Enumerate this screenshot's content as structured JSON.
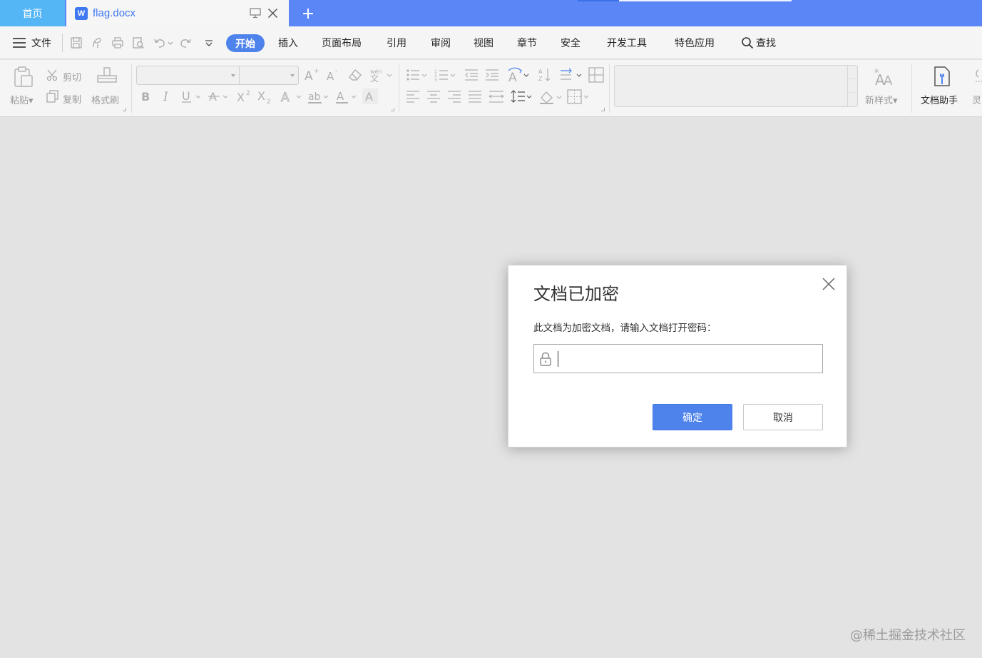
{
  "tabs": {
    "home_label": "首页",
    "doc_icon_letter": "W",
    "doc_title": "flag.docx"
  },
  "menu": {
    "file_label": "文件",
    "items": {
      "start": "开始",
      "insert": "插入",
      "layout": "页面布局",
      "reference": "引用",
      "review": "审阅",
      "view": "视图",
      "chapter": "章节",
      "security": "安全",
      "devtools": "开发工具",
      "features": "特色应用",
      "find": "查找"
    }
  },
  "ribbon": {
    "paste_label": "粘贴",
    "cut_label": "剪切",
    "copy_label": "复制",
    "format_painter_label": "格式刷",
    "font_name": "",
    "font_size": "",
    "new_style_label": "新样式",
    "doc_assistant_label": "文档助手",
    "partial_label": "灵"
  },
  "dialog": {
    "title": "文档已加密",
    "prompt": "此文档为加密文档，请输入文档打开密码：",
    "password_value": "",
    "ok_label": "确定",
    "cancel_label": "取消"
  },
  "watermark": "@稀土掘金技术社区",
  "colors": {
    "tabbar": "#5a86f6",
    "home_tab": "#55b6f5",
    "accent": "#4f83ec",
    "workspace": "#e3e3e3"
  }
}
